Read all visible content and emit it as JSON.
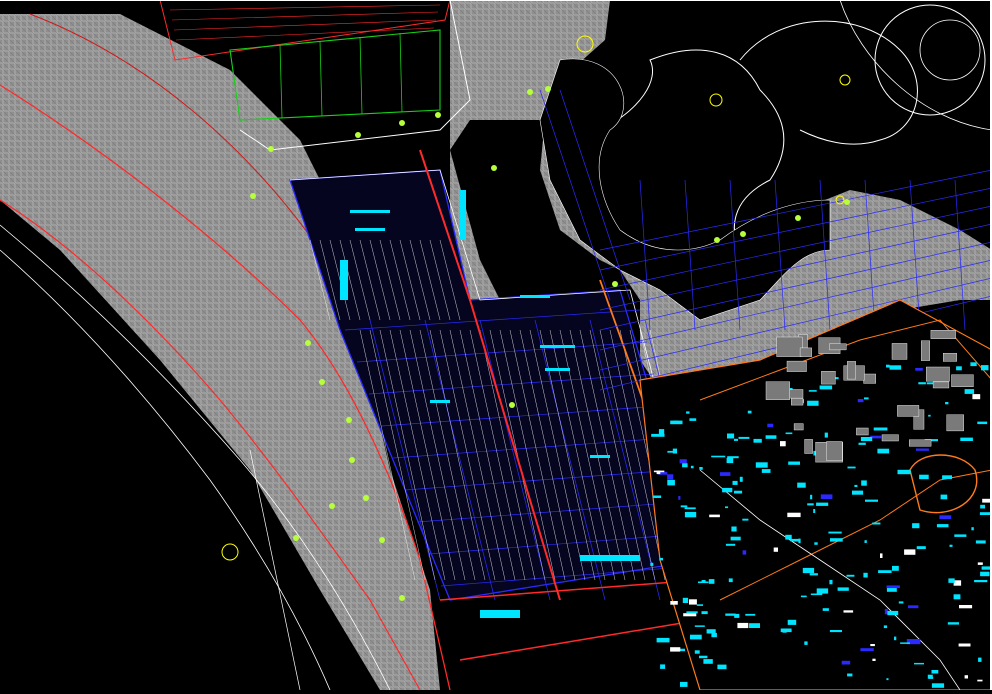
{
  "drawing": {
    "background": "#000000",
    "colors": {
      "hatch": "#9a9a9a",
      "hatch_line": "#bdbdbd",
      "boundary": "#ff2a2a",
      "grid_blue": "#2a2aff",
      "building": "#00e5ff",
      "outline_white": "#ffffff",
      "green": "#18d018",
      "orange": "#ff7a1a",
      "yellow": "#ffff00",
      "point_green": "#b6ff3a"
    },
    "labels": []
  }
}
